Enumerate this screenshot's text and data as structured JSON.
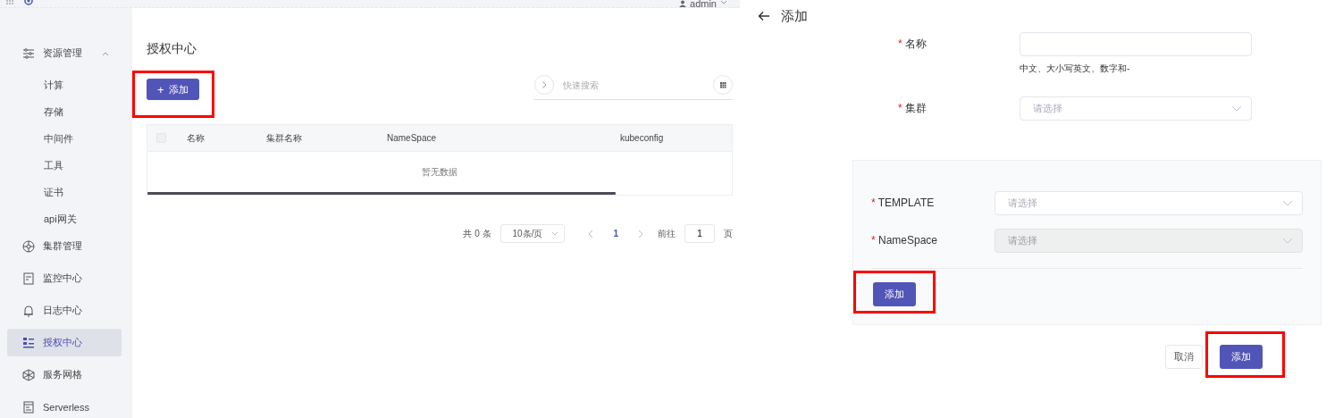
{
  "header": {
    "user": "admin"
  },
  "sidebar": {
    "items": [
      {
        "kind": "group",
        "label": "资源管理",
        "expanded": true,
        "selected": false,
        "children": [
          {
            "label": "计算",
            "selected": false
          },
          {
            "label": "存储",
            "selected": false
          },
          {
            "label": "中间件",
            "selected": false
          },
          {
            "label": "工具",
            "selected": false
          },
          {
            "label": "证书",
            "selected": false
          },
          {
            "label": "api网关",
            "selected": false
          }
        ]
      },
      {
        "kind": "item",
        "label": "集群管理",
        "selected": false
      },
      {
        "kind": "item",
        "label": "监控中心",
        "selected": false
      },
      {
        "kind": "item",
        "label": "日志中心",
        "selected": false
      },
      {
        "kind": "item",
        "label": "授权中心",
        "selected": true
      },
      {
        "kind": "item",
        "label": "服务网格",
        "selected": false
      },
      {
        "kind": "item",
        "label": "Serverless",
        "selected": false
      }
    ]
  },
  "page": {
    "title": "授权中心",
    "add_button": {
      "icon": "+",
      "label": "添加",
      "highlighted": true
    },
    "search": {
      "placeholder": "快速搜索"
    },
    "table": {
      "select_all_checked": false,
      "columns": [
        "名称",
        "集群名称",
        "NameSpace",
        "kubeconfig"
      ],
      "empty_text": "暂无数据"
    },
    "pagination": {
      "total": "共 0 条",
      "page_size": "10条/页",
      "pages": [
        {
          "label": "1",
          "selected": true
        }
      ],
      "goto_label": "前往",
      "goto_value": "1",
      "page_unit": "页"
    }
  },
  "form": {
    "title": "添加",
    "fields": [
      {
        "kind": "input",
        "required_mark": "*",
        "label": "名称",
        "hint": "中文、大小写英文、数字和-"
      },
      {
        "kind": "select",
        "required_mark": "*",
        "label": "集群",
        "placeholder": "请选择"
      }
    ],
    "panel": {
      "fields": [
        {
          "kind": "select",
          "required_mark": "*",
          "label": "TEMPLATE",
          "placeholder": "请选择",
          "disabled": false
        },
        {
          "kind": "select",
          "required_mark": "*",
          "label": "NameSpace",
          "placeholder": "请选择",
          "disabled": true
        }
      ],
      "add_button": {
        "label": "添加",
        "highlighted": true
      }
    },
    "buttons": [
      {
        "kind": "cancel",
        "label": "取消",
        "highlighted": false
      },
      {
        "kind": "primary",
        "label": "添加",
        "highlighted": true
      }
    ]
  }
}
